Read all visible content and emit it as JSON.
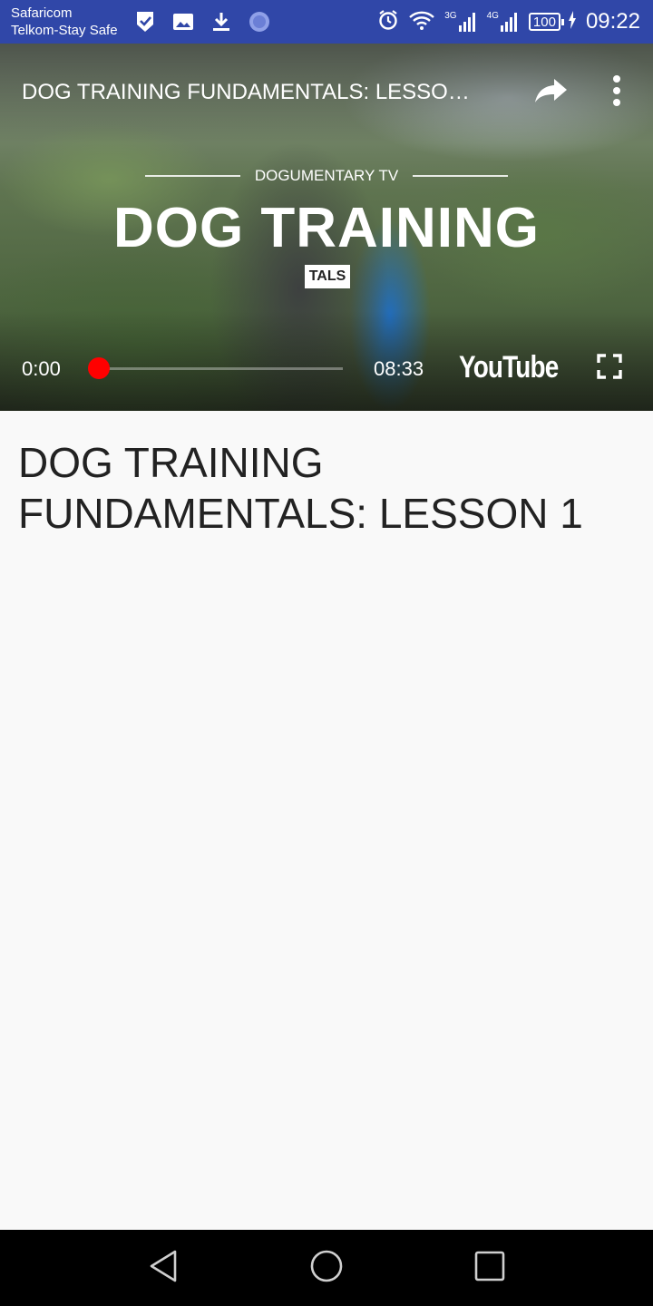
{
  "status_bar": {
    "carrier_line1": "Safaricom",
    "carrier_line2": "Telkom-Stay Safe",
    "network_3g": "3G",
    "network_4g": "4G",
    "battery": "100",
    "time": "09:22",
    "icons": [
      "check-shield-icon",
      "image-icon",
      "download-icon",
      "sync-circle-icon",
      "alarm-icon",
      "wifi-icon",
      "signal-icon",
      "signal-icon",
      "battery-icon",
      "charging-icon"
    ],
    "bg_color": "#3047a8"
  },
  "player": {
    "title": "DOG TRAINING FUNDAMENTALS: LESSO…",
    "overlay_brand": "DOGUMENTARY TV",
    "overlay_headline": "DOG TRAINING",
    "overlay_sub": "TALS",
    "current_time": "0:00",
    "total_time": "08:33",
    "progress": 0,
    "logo": "YouTube",
    "icons": [
      "share-icon",
      "more-vert-icon",
      "fullscreen-icon"
    ],
    "accent_color": "#ff0000"
  },
  "content": {
    "title": "DOG TRAINING FUNDAMENTALS: LESSON 1"
  },
  "nav_bar": {
    "icons": [
      "back-icon",
      "home-icon",
      "recents-icon"
    ]
  }
}
